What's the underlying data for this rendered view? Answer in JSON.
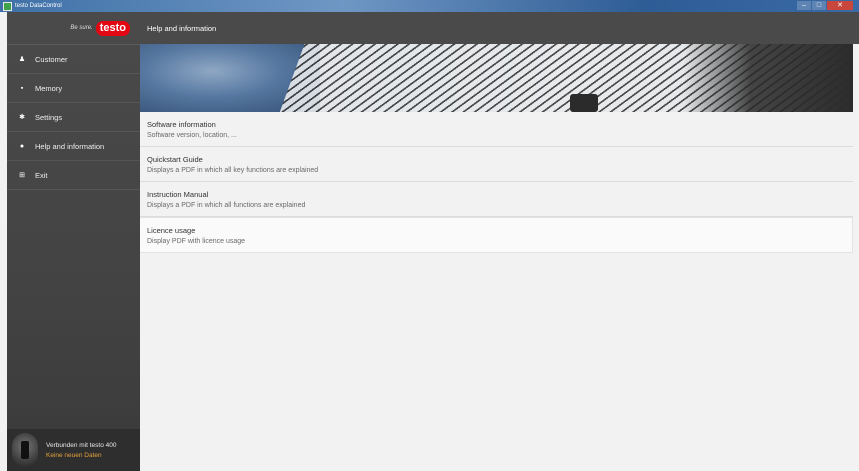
{
  "window": {
    "title": "testo DataControl",
    "min": "–",
    "max": "□",
    "close": "✕"
  },
  "brand": {
    "claim": "Be sure.",
    "logo": "testo"
  },
  "sidebar": {
    "items": [
      {
        "label": "Customer",
        "icon": "user-icon",
        "glyph": "♟"
      },
      {
        "label": "Memory",
        "icon": "memory-icon",
        "glyph": "▪"
      },
      {
        "label": "Settings",
        "icon": "gear-icon",
        "glyph": "✱"
      },
      {
        "label": "Help and information",
        "icon": "info-icon",
        "glyph": "●"
      },
      {
        "label": "Exit",
        "icon": "exit-icon",
        "glyph": "⊞"
      }
    ]
  },
  "device": {
    "status": "Verbunden mit testo 400",
    "data_status": "Keine neuen Daten"
  },
  "header": {
    "title": "Help and information"
  },
  "list": [
    {
      "title": "Software information",
      "subtitle": "Software version, location, ..."
    },
    {
      "title": "Quickstart Guide",
      "subtitle": "Displays a PDF in which all key functions are explained"
    },
    {
      "title": "Instruction Manual",
      "subtitle": "Displays a PDF in which all functions are explained"
    },
    {
      "title": "Licence usage",
      "subtitle": "Display PDF with licence usage"
    }
  ],
  "colors": {
    "accent": "#e30613",
    "sidebar": "#474747",
    "warning_text": "#e6a23c"
  }
}
